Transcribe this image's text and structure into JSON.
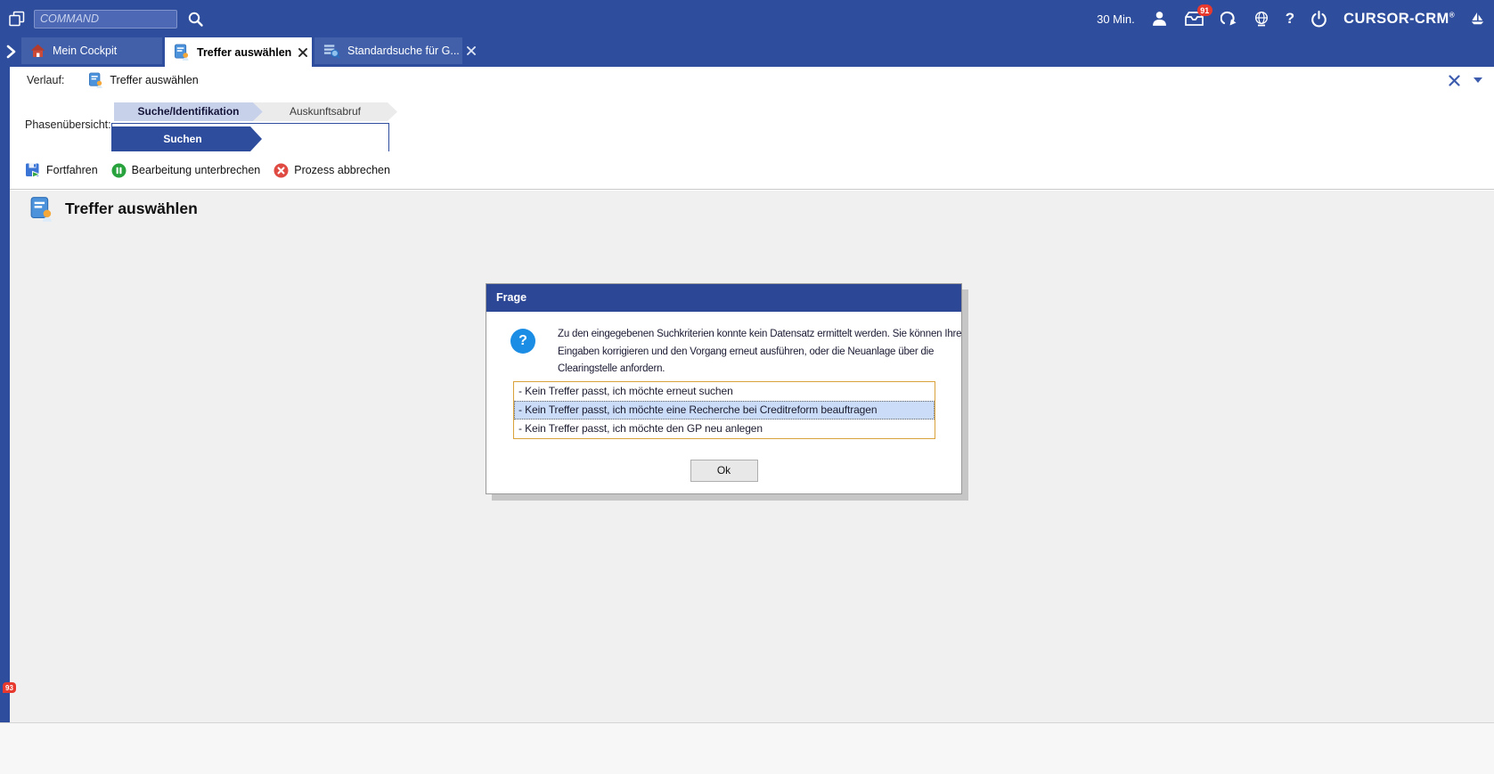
{
  "topbar": {
    "command_placeholder": "COMMAND",
    "timer": "30 Min.",
    "inbox_badge": "91",
    "help_label": "?",
    "brand": "CURSOR-CRM",
    "brand_mark": "®"
  },
  "tabs": [
    {
      "label": "Mein Cockpit",
      "active": false,
      "closable": false
    },
    {
      "label": "Treffer auswählen",
      "active": true,
      "closable": true
    },
    {
      "label": "Standardsuche für G...",
      "active": false,
      "closable": true
    }
  ],
  "verlauf": {
    "label": "Verlauf:",
    "value": "Treffer auswählen"
  },
  "phases": {
    "label": "Phasenübersicht:",
    "steps": [
      {
        "label": "Suche/Identifikation",
        "active": true
      },
      {
        "label": "Auskunftsabruf",
        "active": false
      }
    ],
    "substep": {
      "label": "Suchen",
      "active": true
    }
  },
  "toolbar": {
    "items": [
      {
        "label": "Fortfahren"
      },
      {
        "label": "Bearbeitung unterbrechen"
      },
      {
        "label": "Prozess abbrechen"
      }
    ]
  },
  "main": {
    "title": "Treffer auswählen"
  },
  "dialog": {
    "title": "Frage",
    "icon_glyph": "?",
    "message_lines": [
      "Zu den eingegebenen Suchkriterien konnte kein Datensatz ermittelt werden. Sie können Ihre",
      "Eingaben korrigieren und den Vorgang erneut ausführen, oder die Neuanlage über die",
      "Clearingstelle anfordern."
    ],
    "options": [
      {
        "label": "- Kein Treffer passt, ich möchte erneut suchen",
        "selected": false
      },
      {
        "label": "- Kein Treffer passt, ich möchte eine Recherche bei Creditreform beauftragen",
        "selected": true
      },
      {
        "label": "- Kein Treffer passt, ich möchte den GP neu anlegen",
        "selected": false
      }
    ],
    "ok_label": "Ok"
  },
  "badges": {
    "corner": "93"
  },
  "colors": {
    "accent_blue": "#2e4d9c",
    "tab_inactive": "#4160a9",
    "dialog_title": "#2c4795",
    "selection": "#cadcf7",
    "listbox_border": "#d9a23b",
    "badge_red": "#e8392e",
    "info_icon": "#1b8de4",
    "main_bg": "#f0f0f0"
  }
}
